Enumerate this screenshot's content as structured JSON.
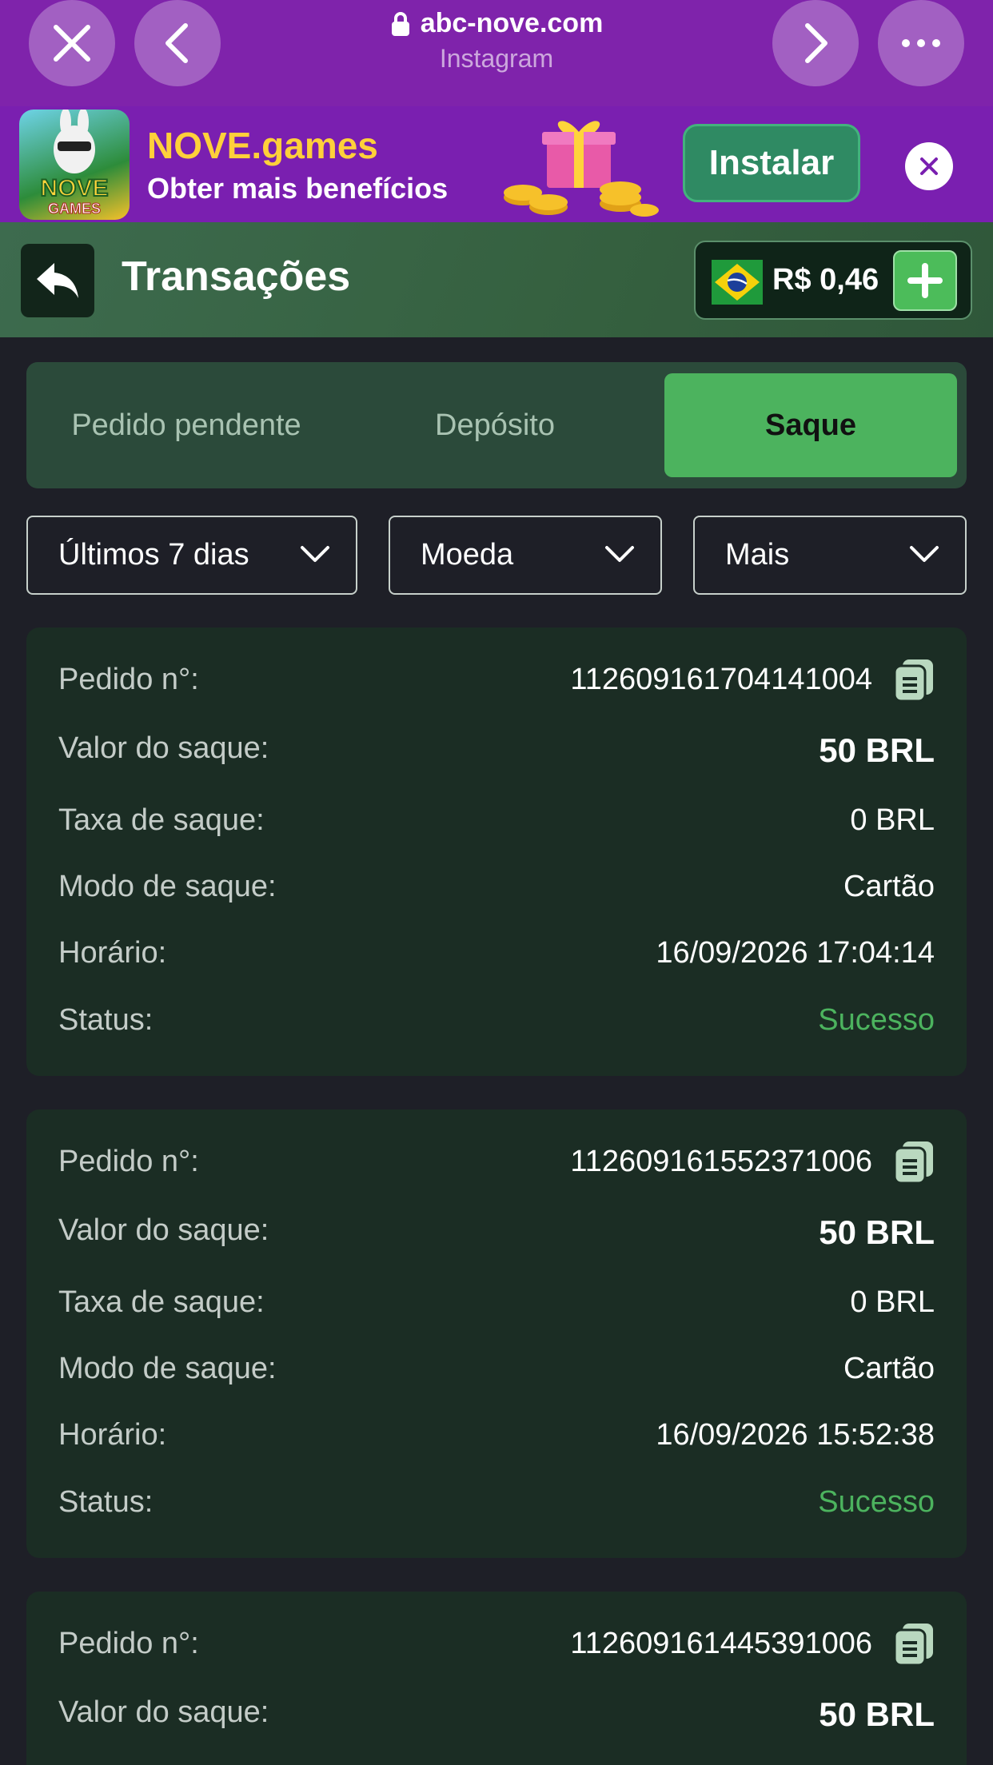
{
  "browser": {
    "url": "abc-nove.com",
    "subtitle": "Instagram"
  },
  "promo": {
    "app_name": "NOVE.games",
    "tagline": "Obter mais benefícios",
    "install_label": "Instalar",
    "logo_text": "NOVE GAMES"
  },
  "header": {
    "title": "Transações",
    "balance": "R$ 0,46"
  },
  "tabs": [
    {
      "label": "Pedido pendente",
      "active": false
    },
    {
      "label": "Depósito",
      "active": false
    },
    {
      "label": "Saque",
      "active": true
    }
  ],
  "filters": {
    "period": "Últimos 7 dias",
    "currency": "Moeda",
    "more": "Mais"
  },
  "labels": {
    "order": "Pedido n°:",
    "amount": "Valor do saque:",
    "fee": "Taxa de saque:",
    "mode": "Modo de saque:",
    "time": "Horário:",
    "status": "Status:"
  },
  "transactions": [
    {
      "order": "112609161704141004",
      "amount": "50 BRL",
      "fee": "0 BRL",
      "mode": "Cartão",
      "time": "16/09/2026 17:04:14",
      "status": "Sucesso"
    },
    {
      "order": "112609161552371006",
      "amount": "50 BRL",
      "fee": "0 BRL",
      "mode": "Cartão",
      "time": "16/09/2026 15:52:38",
      "status": "Sucesso"
    },
    {
      "order": "112609161445391006",
      "amount": "50 BRL"
    }
  ],
  "colors": {
    "browser_bar": "#7f23ab",
    "promo_bg": "#7a1fb0",
    "accent_green": "#4cb35e",
    "card_bg": "#1b2d24",
    "page_bg": "#1e1f27"
  }
}
